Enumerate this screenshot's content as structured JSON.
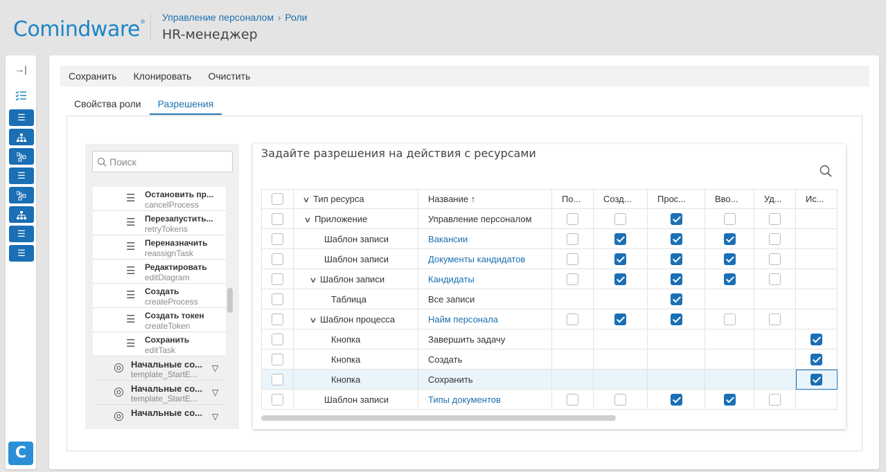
{
  "header": {
    "logo": "Comindware",
    "logo_mark": "®",
    "breadcrumb": [
      "Управление персоналом",
      "Роли"
    ],
    "breadcrumb_sep": "›",
    "title": "HR-менеджер"
  },
  "leftbar": {
    "collapse_icon": "collapse-right-icon",
    "list_icon": "checklist-icon",
    "buttons": [
      "list-icon",
      "hierarchy-icon",
      "workflow-icon",
      "list-icon",
      "workflow-icon",
      "hierarchy-icon",
      "list-icon",
      "list-icon"
    ],
    "app_letter": "C"
  },
  "toolbar": {
    "save": "Сохранить",
    "clone": "Клонировать",
    "clear": "Очистить"
  },
  "tabs": {
    "properties": "Свойства роли",
    "permissions": "Разрешения"
  },
  "tree": {
    "search_placeholder": "Поиск",
    "items": [
      {
        "title": "Остановить пр...",
        "sub": "cancelProcess"
      },
      {
        "title": "Перезапустить...",
        "sub": "retryTokens"
      },
      {
        "title": "Переназначить",
        "sub": "reassignTask"
      },
      {
        "title": "Редактировать",
        "sub": "editDiagram"
      },
      {
        "title": "Создать",
        "sub": "createProcess"
      },
      {
        "title": "Создать токен",
        "sub": "createToken"
      },
      {
        "title": "Сохранить",
        "sub": "editTask"
      }
    ],
    "groups": [
      {
        "title": "Начальные со...",
        "sub": "template_StartE..."
      },
      {
        "title": "Начальные со...",
        "sub": "template_StartE..."
      },
      {
        "title": "Начальные со...",
        "sub": ""
      }
    ]
  },
  "permissions": {
    "title": "Задайте разрешения на действия с ресурсами",
    "columns": {
      "type": "Тип ресурса",
      "name": "Название ↑",
      "c1": "По...",
      "c2": "Созд...",
      "c3": "Прос...",
      "c4": "Вво...",
      "c5": "Уд...",
      "c6": "Ис..."
    },
    "rows": [
      {
        "type": "Приложение",
        "name": "Управление персоналом"
      },
      {
        "type": "Шаблон записи",
        "name": "Вакансии"
      },
      {
        "type": "Шаблон записи",
        "name": "Документы кандидатов"
      },
      {
        "type": "Шаблон записи",
        "name": "Кандидаты"
      },
      {
        "type": "Таблица",
        "name": "Все записи"
      },
      {
        "type": "Шаблон процесса",
        "name": "Найм персонала"
      },
      {
        "type": "Кнопка",
        "name": "Завершить задачу"
      },
      {
        "type": "Кнопка",
        "name": "Создать"
      },
      {
        "type": "Кнопка",
        "name": "Сохранить"
      },
      {
        "type": "Шаблон записи",
        "name": "Типы документов"
      }
    ],
    "checks": [
      [
        false,
        false,
        true,
        false,
        false,
        null
      ],
      [
        false,
        true,
        true,
        true,
        false,
        null
      ],
      [
        false,
        true,
        true,
        true,
        false,
        null
      ],
      [
        false,
        true,
        true,
        true,
        false,
        null
      ],
      [
        null,
        null,
        true,
        null,
        null,
        null
      ],
      [
        false,
        true,
        true,
        false,
        false,
        null
      ],
      [
        null,
        null,
        null,
        null,
        null,
        true
      ],
      [
        null,
        null,
        null,
        null,
        null,
        true
      ],
      [
        null,
        null,
        null,
        null,
        null,
        true
      ],
      [
        false,
        false,
        true,
        true,
        false,
        null
      ]
    ]
  },
  "colors": {
    "accent": "#1a6fb5",
    "logo": "#1b86c6"
  }
}
